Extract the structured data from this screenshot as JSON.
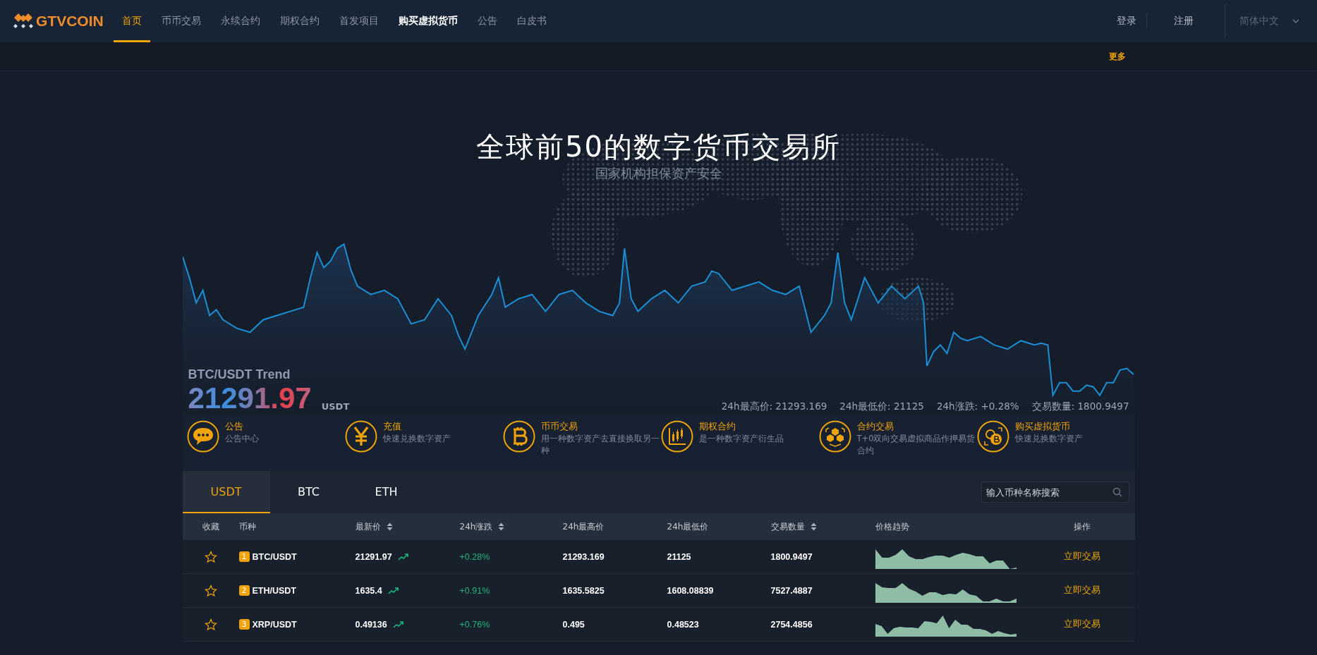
{
  "brand": {
    "name": "GTVCOIN"
  },
  "nav": [
    {
      "label": "首页",
      "selected": true,
      "emphasized": false
    },
    {
      "label": "币币交易",
      "selected": false,
      "emphasized": false
    },
    {
      "label": "永续合约",
      "selected": false,
      "emphasized": false
    },
    {
      "label": "期权合约",
      "selected": false,
      "emphasized": false
    },
    {
      "label": "首发项目",
      "selected": false,
      "emphasized": false
    },
    {
      "label": "购买虚拟货币",
      "selected": false,
      "emphasized": true
    },
    {
      "label": "公告",
      "selected": false,
      "emphasized": false
    },
    {
      "label": "白皮书",
      "selected": false,
      "emphasized": false
    }
  ],
  "account": {
    "login": "登录",
    "register": "注册",
    "language": "简体中文"
  },
  "notice_bar": {
    "more": "更多"
  },
  "hero": {
    "title": "全球前50的数字货币交易所",
    "subtitle": "国家机构担保资产安全"
  },
  "trend": {
    "title": "BTC/USDT Trend",
    "price": "21291.97",
    "unit": "USDT",
    "stats": [
      "24h最高价: 21293.169",
      "24h最低价: 21125",
      "24h涨跌: +0.28%",
      "交易数量: 1800.9497"
    ]
  },
  "features": [
    {
      "title": "公告",
      "desc": "公告中心"
    },
    {
      "title": "充值",
      "desc": "快速兑换数字资产"
    },
    {
      "title": "币币交易",
      "desc": "用一种数字资产去直接换取另一种"
    },
    {
      "title": "期权合约",
      "desc": "是一种数字资产衍生品"
    },
    {
      "title": "合约交易",
      "desc": "T+0双向交易虚拟商品作押易货合约"
    },
    {
      "title": "购买虚拟货币",
      "desc": "快速兑换数字资产"
    }
  ],
  "market_tabs": [
    {
      "label": "USDT",
      "selected": true
    },
    {
      "label": "BTC",
      "selected": false
    },
    {
      "label": "ETH",
      "selected": false
    }
  ],
  "search": {
    "placeholder": "输入币种名称搜索"
  },
  "table": {
    "columns": [
      {
        "label": "收藏",
        "sortable": false
      },
      {
        "label": "币种",
        "sortable": false
      },
      {
        "label": "最新价",
        "sortable": true
      },
      {
        "label": "24h涨跌",
        "sortable": true
      },
      {
        "label": "24h最高价",
        "sortable": false
      },
      {
        "label": "24h最低价",
        "sortable": false
      },
      {
        "label": "交易数量",
        "sortable": true
      },
      {
        "label": "价格趋势",
        "sortable": false
      },
      {
        "label": "操作",
        "sortable": false
      }
    ],
    "rows": [
      {
        "favorited": false,
        "rank": "1",
        "pair": "BTC/USDT",
        "price": "21291.97",
        "change": "+0.28%",
        "rising": true,
        "high": "21293.169",
        "low": "21125",
        "volume": "1800.9497",
        "action": "立即交易"
      },
      {
        "favorited": false,
        "rank": "2",
        "pair": "ETH/USDT",
        "price": "1635.4",
        "change": "+0.91%",
        "rising": true,
        "high": "1635.5825",
        "low": "1608.08839",
        "volume": "7527.4887",
        "action": "立即交易"
      },
      {
        "favorited": false,
        "rank": "3",
        "pair": "XRP/USDT",
        "price": "0.49136",
        "change": "+0.76%",
        "rising": true,
        "high": "0.495",
        "low": "0.48523",
        "volume": "2754.4856",
        "action": "立即交易"
      }
    ]
  }
}
